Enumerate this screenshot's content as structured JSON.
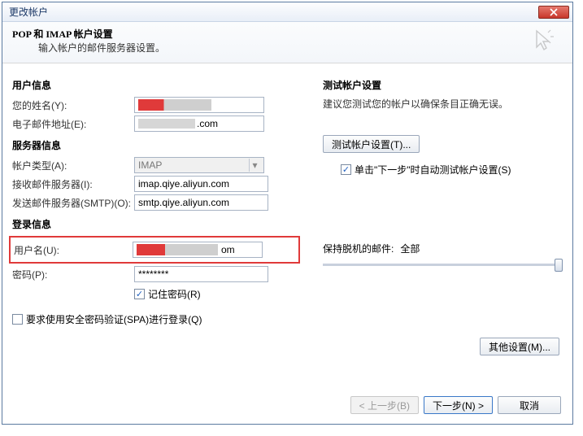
{
  "window": {
    "title": "更改帐户"
  },
  "header": {
    "title": "POP 和 IMAP 帐户设置",
    "subtitle": "输入帐户的邮件服务器设置。"
  },
  "left": {
    "userInfoTitle": "用户信息",
    "nameLabel": "您的姓名(Y):",
    "emailLabel": "电子邮件地址(E):",
    "emailSuffix": ".com",
    "serverInfoTitle": "服务器信息",
    "accountTypeLabel": "帐户类型(A):",
    "accountTypeValue": "IMAP",
    "incomingLabel": "接收邮件服务器(I):",
    "incomingValue": "imap.qiye.aliyun.com",
    "outgoingLabel": "发送邮件服务器(SMTP)(O):",
    "outgoingValue": "smtp.qiye.aliyun.com",
    "loginInfoTitle": "登录信息",
    "usernameLabel": "用户名(U):",
    "usernameSuffix": "om",
    "passwordLabel": "密码(P):",
    "passwordValue": "********",
    "rememberPasswordLabel": "记住密码(R)",
    "spaLabel": "要求使用安全密码验证(SPA)进行登录(Q)"
  },
  "right": {
    "testTitle": "测试帐户设置",
    "testDesc": "建议您测试您的帐户以确保条目正确无误。",
    "testButton": "测试帐户设置(T)...",
    "autoTestLabel": "单击\"下一步\"时自动测试帐户设置(S)",
    "offlineLabel": "保持脱机的邮件:",
    "offlineValue": "全部",
    "otherSettingsButton": "其他设置(M)..."
  },
  "footer": {
    "back": "< 上一步(B)",
    "next": "下一步(N) >",
    "cancel": "取消"
  }
}
